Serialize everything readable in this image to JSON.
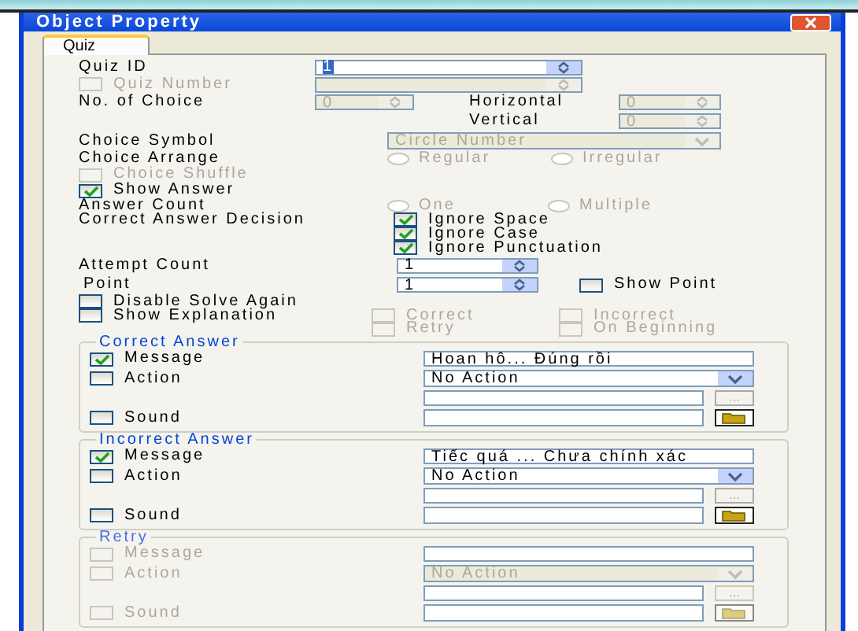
{
  "window": {
    "title": "Object Property"
  },
  "tabs": [
    {
      "label": "Quiz",
      "selected": true
    }
  ],
  "quiz_id": {
    "label": "Quiz ID",
    "value": "1"
  },
  "quiz_number": {
    "label": "Quiz Number",
    "checked": false,
    "disabled": true
  },
  "no_of_choice": {
    "label": "No. of Choice",
    "value": "0",
    "disabled": true
  },
  "horizontal": {
    "label": "Horizontal",
    "value": "0",
    "disabled": true
  },
  "vertical": {
    "label": "Vertical",
    "value": "0",
    "disabled": true
  },
  "choice_symbol": {
    "label": "Choice Symbol",
    "value": "Circle Number",
    "disabled": true
  },
  "choice_arrange": {
    "label": "Choice Arrange",
    "disabled": true,
    "options": [
      {
        "label": "Regular",
        "selected": false
      },
      {
        "label": "Irregular",
        "selected": false
      }
    ]
  },
  "choice_shuffle": {
    "label": "Choice Shuffle",
    "checked": false,
    "disabled": true
  },
  "show_answer": {
    "label": "Show Answer",
    "checked": true,
    "disabled": false
  },
  "answer_count": {
    "label": "Answer Count",
    "disabled": true,
    "options": [
      {
        "label": "One",
        "selected": false
      },
      {
        "label": "Multiple",
        "selected": false
      }
    ]
  },
  "correct_answer_decision": {
    "label": "Correct Answer Decision",
    "options": [
      {
        "label": "Ignore Space",
        "checked": true
      },
      {
        "label": "Ignore Case",
        "checked": true
      },
      {
        "label": "Ignore Punctuation",
        "checked": true
      }
    ]
  },
  "attempt_count": {
    "label": "Attempt Count",
    "value": "1"
  },
  "point": {
    "label": "Point",
    "value": "1"
  },
  "show_point": {
    "label": "Show Point",
    "checked": false,
    "disabled": false
  },
  "disable_solve_again": {
    "label": "Disable Solve Again",
    "checked": false,
    "disabled": false
  },
  "show_explanation": {
    "label": "Show Explanation",
    "checked": false,
    "disabled": false
  },
  "explanation_targets": [
    {
      "label": "Correct",
      "checked": false,
      "disabled": true
    },
    {
      "label": "Incorrect",
      "checked": false,
      "disabled": true
    },
    {
      "label": "Retry",
      "checked": false,
      "disabled": true
    },
    {
      "label": "On Beginning",
      "checked": false,
      "disabled": true
    }
  ],
  "groups": [
    {
      "title": "Correct Answer",
      "disabled": false,
      "message": {
        "label": "Message",
        "checked": true,
        "value": "Hoan hô... Đúng rồi"
      },
      "action": {
        "label": "Action",
        "checked": false,
        "value": "No Action"
      },
      "browse": "...",
      "sound": {
        "label": "Sound",
        "checked": false
      }
    },
    {
      "title": "Incorrect Answer",
      "disabled": false,
      "message": {
        "label": "Message",
        "checked": true,
        "value": "Tiếc quá ... Chưa chính xác"
      },
      "action": {
        "label": "Action",
        "checked": false,
        "value": "No Action"
      },
      "browse": "...",
      "sound": {
        "label": "Sound",
        "checked": false
      }
    },
    {
      "title": "Retry",
      "disabled": true,
      "message": {
        "label": "Message",
        "checked": false
      },
      "action": {
        "label": "Action",
        "checked": false,
        "value": "No Action"
      },
      "browse": "...",
      "sound": {
        "label": "Sound",
        "checked": false
      }
    }
  ]
}
